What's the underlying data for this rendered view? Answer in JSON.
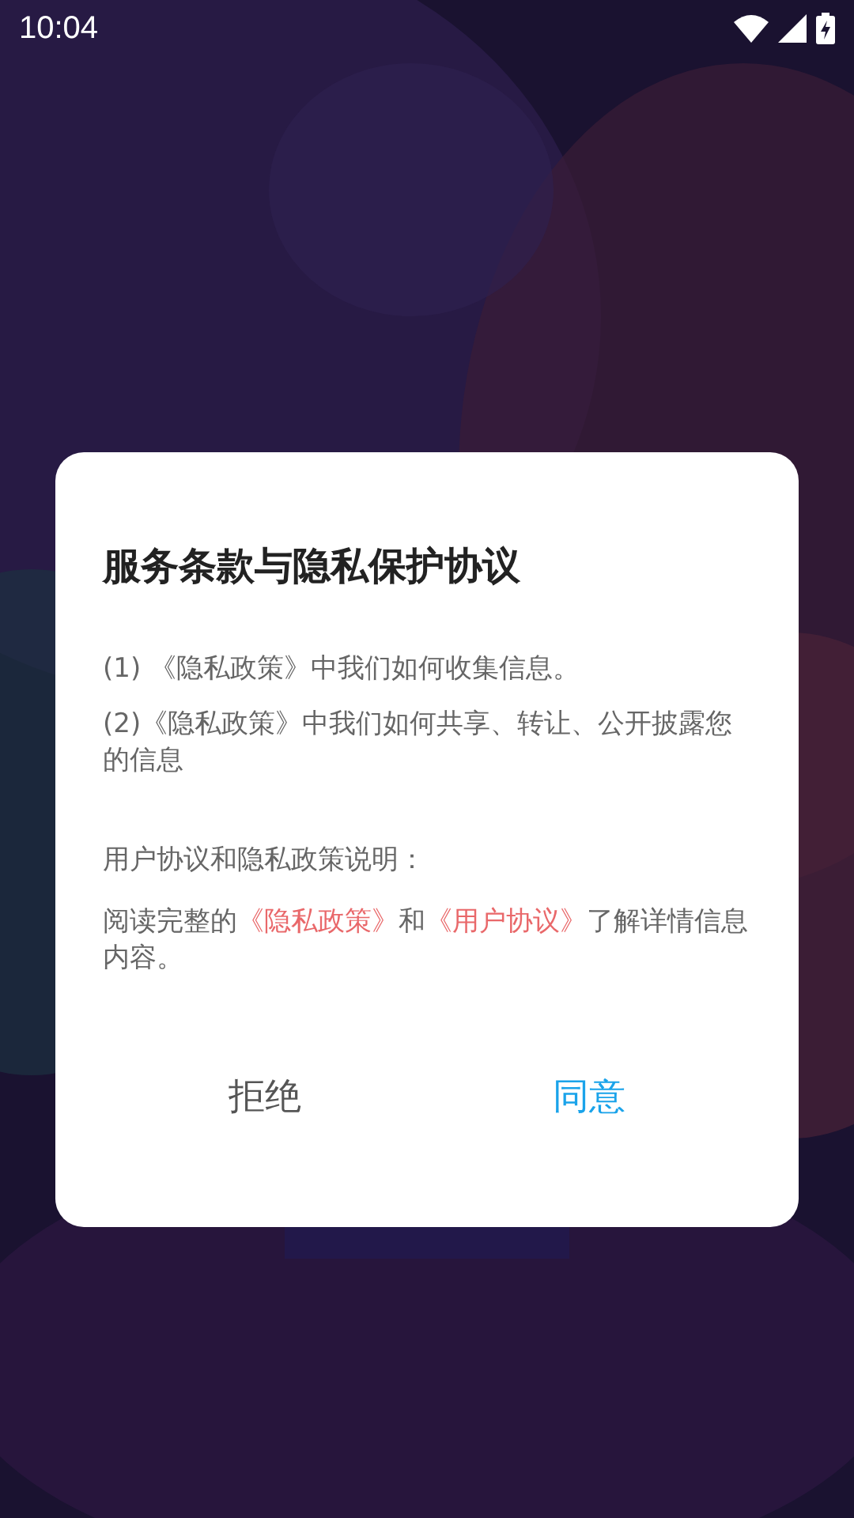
{
  "status_bar": {
    "time": "10:04"
  },
  "dialog": {
    "title": "服务条款与隐私保护协议",
    "items": [
      "(1) 《隐私政策》中我们如何收集信息。",
      "(2)《隐私政策》中我们如何共享、转让、公开披露您的信息"
    ],
    "section_title": "用户协议和隐私政策说明：",
    "note": [
      {
        "text": "阅读完整的",
        "kind": "plain"
      },
      {
        "text": "《隐私政策》",
        "kind": "link"
      },
      {
        "text": "和",
        "kind": "plain"
      },
      {
        "text": "《用户协议》",
        "kind": "link"
      },
      {
        "text": "了解详情信息内容。",
        "kind": "plain"
      }
    ],
    "buttons": [
      {
        "label": "拒绝",
        "kind": "secondary"
      },
      {
        "label": "同意",
        "kind": "primary"
      }
    ]
  }
}
